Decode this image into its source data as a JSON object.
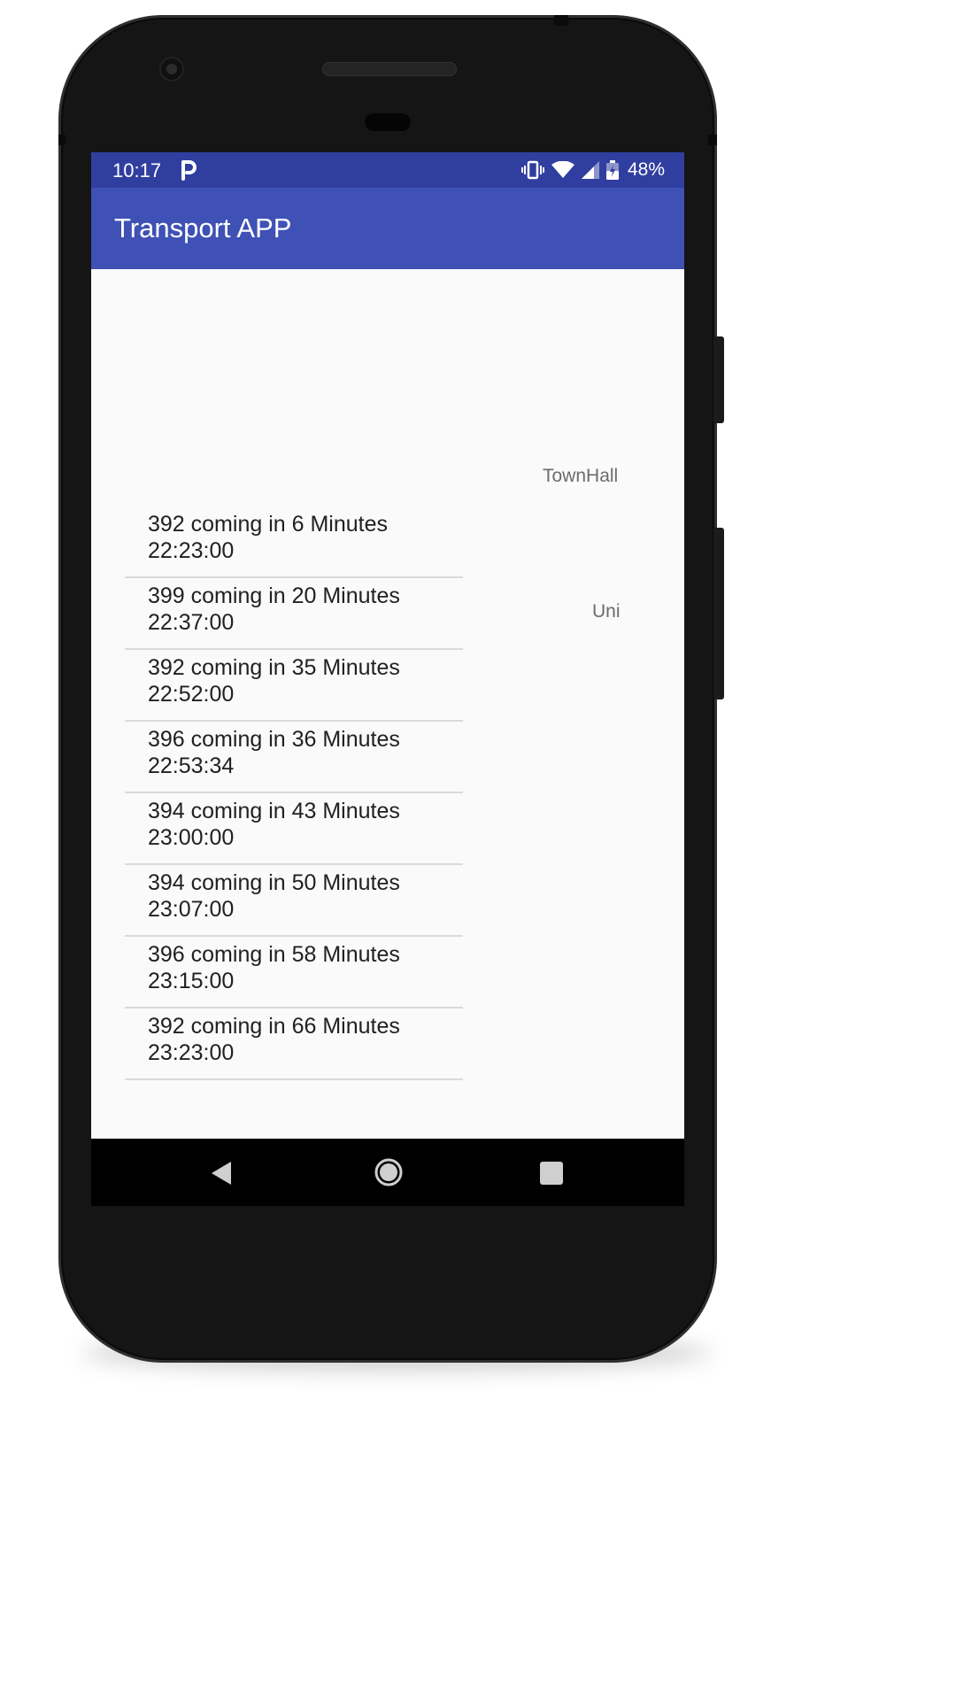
{
  "status_bar": {
    "time": "10:17",
    "battery": "48%",
    "icons": [
      "parking-icon",
      "vibrate-icon",
      "wifi-icon",
      "signal-icon",
      "battery-icon"
    ]
  },
  "app_bar": {
    "title": "Transport APP"
  },
  "stops": {
    "townhall": "TownHall",
    "uni": "Uni"
  },
  "arrivals": [
    {
      "line": "392 coming in 6 Minutes",
      "time": "22:23:00"
    },
    {
      "line": "399 coming in 20 Minutes",
      "time": "22:37:00"
    },
    {
      "line": "392 coming in 35 Minutes",
      "time": "22:52:00"
    },
    {
      "line": "396 coming in 36 Minutes",
      "time": "22:53:34"
    },
    {
      "line": "394 coming in 43 Minutes",
      "time": "23:00:00"
    },
    {
      "line": "394 coming in 50 Minutes",
      "time": "23:07:00"
    },
    {
      "line": "396 coming in 58 Minutes",
      "time": "23:15:00"
    },
    {
      "line": "392 coming in 66 Minutes",
      "time": "23:23:00"
    }
  ],
  "nav_bar": {
    "icons": [
      "back-icon",
      "home-icon",
      "recents-icon"
    ]
  },
  "colors": {
    "status_bar": "#303F9F",
    "app_bar": "#3F51B5",
    "background": "#fafafa"
  }
}
